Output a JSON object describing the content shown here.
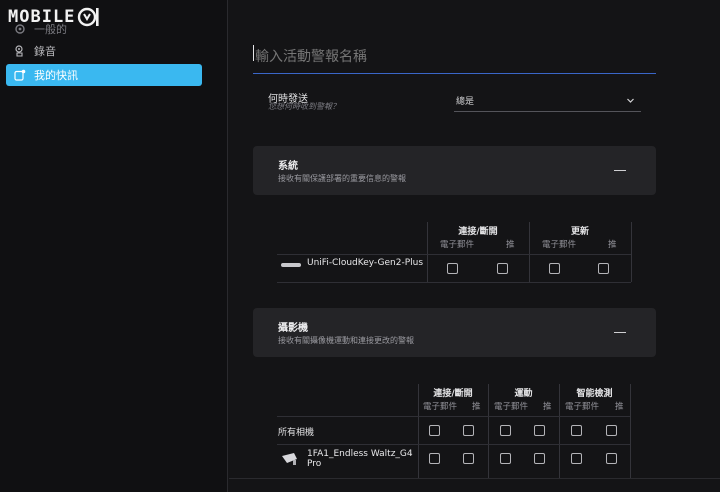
{
  "sidebar": {
    "logo_text": "MOBILE",
    "items": [
      {
        "label": "一般的",
        "icon": "gear-icon"
      },
      {
        "label": "錄音",
        "icon": "recording-icon"
      },
      {
        "label": "我的快訊",
        "icon": "alert-icon",
        "active": true
      }
    ]
  },
  "form": {
    "title_placeholder": "輸入活動警報名稱",
    "when": {
      "label": "何時發送",
      "sub": "您想何時收到警報？",
      "value": "總是"
    }
  },
  "system": {
    "title": "系統",
    "desc": "接收有關保護部署的重要信息的警報",
    "groups": [
      "連接/斷開",
      "更新"
    ],
    "subcols": [
      "電子郵件",
      "推",
      "電子郵件",
      "推"
    ],
    "device": "UniFi-CloudKey-Gen2-Plus"
  },
  "camera": {
    "title": "攝影機",
    "desc": "接收有關攝像機運動和連接更改的警報",
    "groups": [
      "連接/斷開",
      "運動",
      "智能檢測"
    ],
    "subcols": [
      "電子郵件",
      "推",
      "電子郵件",
      "推",
      "電子郵件",
      "推"
    ],
    "all_label": "所有相機",
    "device": "1FA1_Endless Waltz_G4 Pro"
  },
  "colors": {
    "accent": "#3ab8f0",
    "underline": "#3a66c8",
    "panel": "#242427",
    "background": "#141416"
  }
}
